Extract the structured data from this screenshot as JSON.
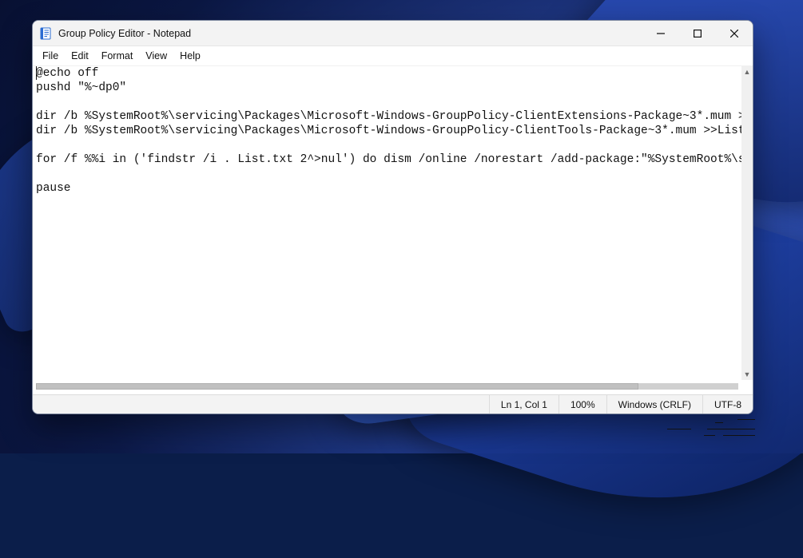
{
  "window": {
    "title": "Group Policy Editor - Notepad"
  },
  "menu": {
    "file": "File",
    "edit": "Edit",
    "format": "Format",
    "view": "View",
    "help": "Help"
  },
  "editor": {
    "content": "@echo off\npushd \"%~dp0\"\n\ndir /b %SystemRoot%\\servicing\\Packages\\Microsoft-Windows-GroupPolicy-ClientExtensions-Package~3*.mum >List.txt\ndir /b %SystemRoot%\\servicing\\Packages\\Microsoft-Windows-GroupPolicy-ClientTools-Package~3*.mum >>List.txt\n\nfor /f %%i in ('findstr /i . List.txt 2^>nul') do dism /online /norestart /add-package:\"%SystemRoot%\\servicing\n\npause"
  },
  "statusbar": {
    "position": "Ln 1, Col 1",
    "zoom": "100%",
    "line_ending": "Windows (CRLF)",
    "encoding_partial": "UTF-8"
  }
}
